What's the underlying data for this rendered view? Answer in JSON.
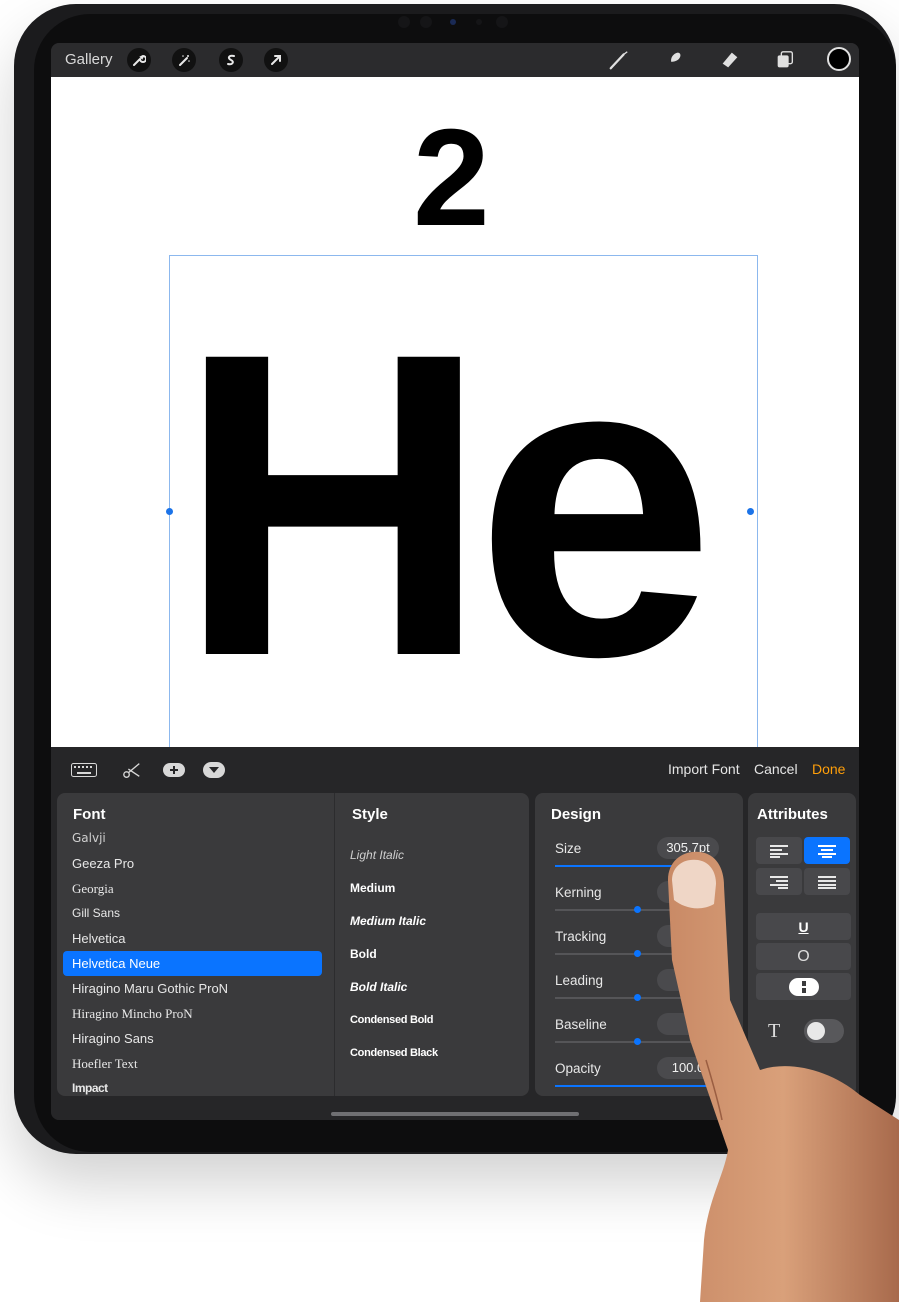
{
  "topbar": {
    "gallery_label": "Gallery",
    "left_tools": [
      "wrench-icon",
      "magic-wand-icon",
      "selection-icon",
      "transform-arrow-icon"
    ],
    "right_tools": [
      "brush-icon",
      "smudge-icon",
      "eraser-icon",
      "layers-icon"
    ],
    "current_color": "#000000"
  },
  "canvas": {
    "layer_number": "2",
    "text_content": "He",
    "selection_color": "#8cb8ee"
  },
  "panel_toolbar": {
    "icons": [
      "keyboard-icon",
      "scissors-icon",
      "plus-circle-icon",
      "chevron-down-circle-icon"
    ],
    "import_font": "Import Font",
    "cancel": "Cancel",
    "done": "Done",
    "done_color": "#ff9f0a"
  },
  "font_panel": {
    "title": "Font",
    "fonts": [
      "Galvji",
      "Geeza Pro",
      "Georgia",
      "Gill Sans",
      "Helvetica",
      "Helvetica Neue",
      "Hiragino Maru Gothic ProN",
      "Hiragino Mincho ProN",
      "Hiragino Sans",
      "Hoefler Text",
      "Impact"
    ],
    "selected": "Helvetica Neue",
    "accent": "#0a74ff"
  },
  "style_panel": {
    "title": "Style",
    "styles": [
      "Light Italic",
      "Medium",
      "Medium Italic",
      "Bold",
      "Bold Italic",
      "Condensed Bold",
      "Condensed Black"
    ]
  },
  "design_panel": {
    "title": "Design",
    "rows": [
      {
        "label": "Size",
        "value": "305.7pt",
        "fill": 0.85
      },
      {
        "label": "Kerning",
        "value": "",
        "fill": 0.5
      },
      {
        "label": "Tracking",
        "value": "",
        "fill": 0.5
      },
      {
        "label": "Leading",
        "value": "",
        "fill": 0.5
      },
      {
        "label": "Baseline",
        "value": "",
        "fill": 0.5
      },
      {
        "label": "Opacity",
        "value": "100.0",
        "fill": 1.0
      }
    ]
  },
  "attributes_panel": {
    "title": "Attributes",
    "alignment": [
      "align-left-icon",
      "align-center-icon",
      "align-right-icon",
      "align-justify-icon"
    ],
    "selected_alignment": "align-center-icon",
    "underline": "U",
    "outline": "O",
    "vertical_text_icon": "vertical-text-icon",
    "text_glyph": "T"
  }
}
